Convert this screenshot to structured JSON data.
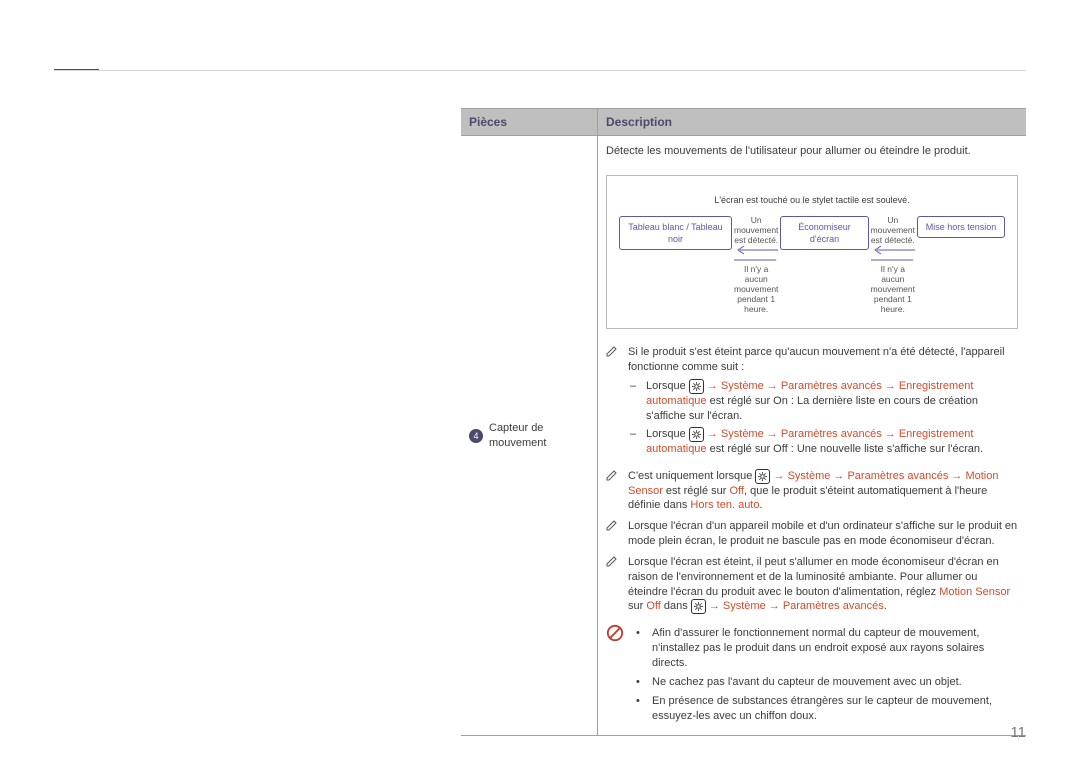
{
  "page_number": "11",
  "table": {
    "headers": {
      "col1": "Pièces",
      "col2": "Description"
    },
    "row": {
      "num": "4",
      "name": "Capteur de mouvement",
      "intro": "Détecte les mouvements de l'utilisateur pour allumer ou éteindre le produit.",
      "diagram": {
        "title": "L'écran est touché ou le stylet tactile est soulevé.",
        "state1": "Tableau blanc / Tableau noir",
        "state2": "Économiseur d'écran",
        "state3": "Mise hors tension",
        "arrow_up1": "Un mouvement est détecté.",
        "arrow_up2": "Un mouvement est détecté.",
        "arrow_down1": "Il n'y a aucun mouvement pendant 1 heure.",
        "arrow_down2": "Il n'y a aucun mouvement pendant 1 heure."
      },
      "note1": {
        "lead": "Si le produit s'est éteint parce qu'aucun mouvement n'a été détecté, l'appareil fonctionne comme suit :",
        "item1_pre": "Lorsque ",
        "item1_path": " → Système → Paramètres avancés → Enregistrement automatique",
        "item1_post": " est réglé sur On : La dernière liste en cours de création s'affiche sur l'écran.",
        "item2_pre": "Lorsque ",
        "item2_path": " → Système → Paramètres avancés → Enregistrement automatique",
        "item2_post": " est réglé sur Off : Une nouvelle liste s'affiche sur l'écran."
      },
      "note2": {
        "pre": "C'est uniquement lorsque ",
        "path": " → Système → Paramètres avancés → Motion Sensor",
        "mid": " est réglé sur ",
        "off": "Off",
        "post": ", que le produit s'éteint automatiquement à l'heure définie dans ",
        "hors": "Hors ten. auto",
        "dot": "."
      },
      "note3": "Lorsque l'écran d'un appareil mobile et d'un ordinateur s'affiche sur le produit en mode plein écran, le produit ne bascule pas en mode économiseur d'écran.",
      "note4": {
        "pre": "Lorsque l'écran est éteint, il peut s'allumer en mode économiseur d'écran en raison de l'environnement et de la luminosité ambiante. Pour allumer ou éteindre l'écran du produit avec le bouton d'alimentation, réglez ",
        "ms": "Motion Sensor",
        "mid": " sur ",
        "off": "Off",
        "post1": " dans ",
        "path": " → Système → Paramètres avancés",
        "dot": "."
      },
      "prohibit": {
        "b1": "Afin d'assurer le fonctionnement normal du capteur de mouvement, n'installez pas le produit dans un endroit exposé aux rayons solaires directs.",
        "b2": "Ne cachez pas l'avant du capteur de mouvement avec un objet.",
        "b3": "En présence de substances étrangères sur le capteur de mouvement, essuyez-les avec un chiffon doux."
      }
    }
  }
}
